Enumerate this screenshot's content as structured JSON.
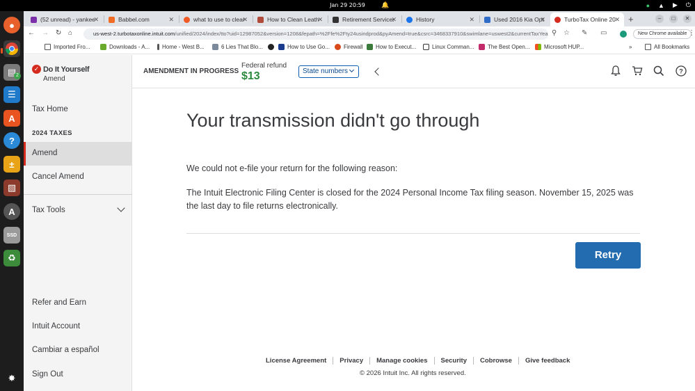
{
  "system": {
    "datetime": "Jan 29  20:59"
  },
  "dock": {
    "badge_count": "2",
    "icons": [
      "firefox-icon",
      "chrome-icon",
      "files-icon",
      "writer-icon",
      "app-center-icon",
      "help-icon",
      "calc-icon",
      "books-icon",
      "software-updater-icon",
      "ssd-icon",
      "trash-icon",
      "apps-grid-icon"
    ]
  },
  "browser": {
    "tabs": [
      {
        "title": "(52 unread) - yankee",
        "active": false
      },
      {
        "title": "Babbel.com",
        "active": false
      },
      {
        "title": "what to use to clean",
        "active": false
      },
      {
        "title": "How to Clean Leath",
        "active": false
      },
      {
        "title": "Retirement Services",
        "active": false
      },
      {
        "title": "History",
        "active": false
      },
      {
        "title": "Used 2016 Kia Optim",
        "active": false
      },
      {
        "title": "TurboTax Online 20",
        "active": true
      }
    ],
    "url_host": "us-west-2.turbotaxonline.intuit.com",
    "url_path": "/unified/2024/index/tto?uid=12987052&version=1208&fepath=%2Ffe%2Fty24usindprod&pyAmend=true&csrc=3468337910&swimlane=uswest2&currentTaxYear...",
    "new_chrome_label": "New Chrome available",
    "bookmarks": [
      "Imported Fro...",
      "Downloads - A...",
      "Home - West B...",
      "6 Lies That Blo...",
      "",
      "How to Use Go...",
      "Firewall",
      "How to Execut...",
      "Linux Comman...",
      "The Best Open...",
      "Microsoft HUP..."
    ],
    "all_bookmarks": "All Bookmarks"
  },
  "sidebar": {
    "brand": "Do It Yourself",
    "brand_sub": "Amend",
    "tax_home": "Tax Home",
    "section_heading": "2024 TAXES",
    "amend": "Amend",
    "cancel_amend": "Cancel Amend",
    "tax_tools": "Tax Tools",
    "refer": "Refer and Earn",
    "account": "Intuit Account",
    "language": "Cambiar a español",
    "sign_out": "Sign Out"
  },
  "header": {
    "status": "AMENDMENT IN PROGRESS",
    "refund_label": "Federal refund",
    "refund_amount": "$13",
    "state_button": "State numbers"
  },
  "main": {
    "title": "Your transmission didn't go through",
    "intro": "We could not e-file your return for the following reason:",
    "reason": "The Intuit Electronic Filing Center is closed for the 2024 Personal Income Tax filing season. November 15, 2025 was the last day to file returns electronically.",
    "retry": "Retry"
  },
  "footer": {
    "links": [
      "License Agreement",
      "Privacy",
      "Manage cookies",
      "Security",
      "Cobrowse",
      "Give feedback"
    ],
    "copyright": "© 2026 Intuit Inc. All rights reserved."
  },
  "colors": {
    "brand_red": "#d52b1e",
    "refund_green": "#2a8a3e",
    "primary_blue": "#236cb0"
  }
}
